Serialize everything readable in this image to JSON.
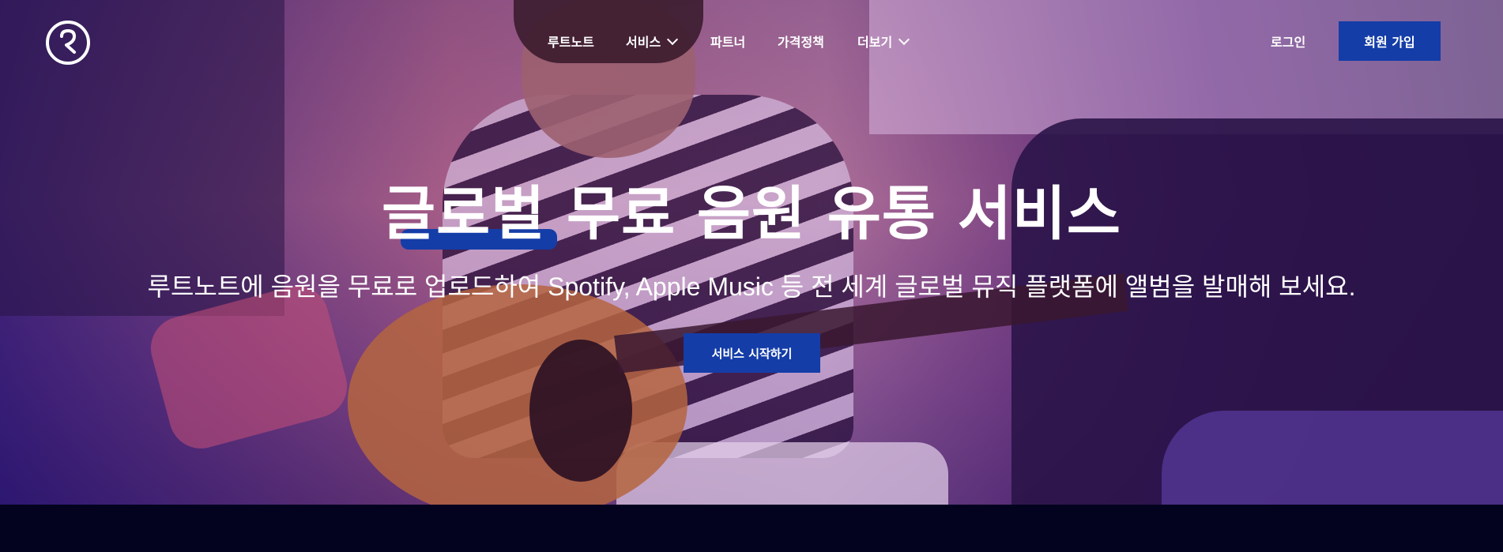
{
  "brand": {
    "logo_icon": "rootnote-logo-icon"
  },
  "nav": {
    "items": [
      {
        "label": "루트노트",
        "has_dropdown": false
      },
      {
        "label": "서비스",
        "has_dropdown": true
      },
      {
        "label": "파트너",
        "has_dropdown": false
      },
      {
        "label": "가격정책",
        "has_dropdown": false
      },
      {
        "label": "더보기",
        "has_dropdown": true
      }
    ],
    "login_label": "로그인",
    "signup_label": "회원 가입"
  },
  "hero": {
    "title": "글로벌 무료 음원 유통 서비스",
    "subtitle": "루트노트에 음원을 무료로 업로드하여 Spotify, Apple Music 등 전 세계 글로벌 뮤직 플랫폼에 앨범을 발매해 보세요.",
    "cta_label": "서비스 시작하기"
  },
  "colors": {
    "accent": "#143da8",
    "footer_band": "#03031f"
  }
}
